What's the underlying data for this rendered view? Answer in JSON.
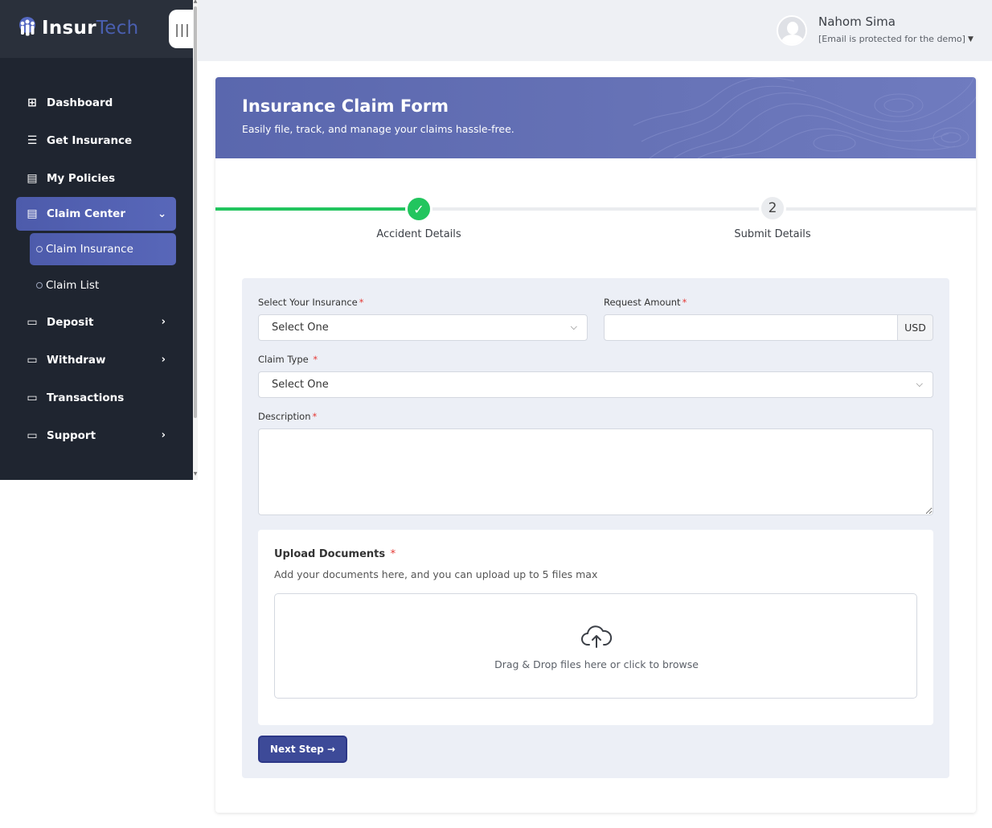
{
  "brand": {
    "name_part1": "Insur",
    "name_part2": "Tech"
  },
  "sidebar": {
    "collapse_label": "|||",
    "items": [
      {
        "label": "Dashboard",
        "icon": "grid-icon",
        "glyph": "⊞"
      },
      {
        "label": "Get Insurance",
        "icon": "list-check-icon",
        "glyph": "☰"
      },
      {
        "label": "My Policies",
        "icon": "document-icon",
        "glyph": "▤"
      },
      {
        "label": "Claim Center",
        "icon": "document-icon",
        "glyph": "▤"
      },
      {
        "label": "Deposit",
        "icon": "cash-icon",
        "glyph": "▭"
      },
      {
        "label": "Withdraw",
        "icon": "cash-icon",
        "glyph": "▭"
      },
      {
        "label": "Transactions",
        "icon": "card-icon",
        "glyph": "▭"
      },
      {
        "label": "Support",
        "icon": "ticket-icon",
        "glyph": "▭"
      }
    ],
    "claim_sub": [
      {
        "label": "Claim Insurance"
      },
      {
        "label": "Claim List"
      }
    ]
  },
  "header": {
    "user_name": "Nahom Sima",
    "user_email": "[Email is protected for the demo]"
  },
  "banner": {
    "title": "Insurance Claim Form",
    "subtitle": "Easily file, track, and manage your claims hassle-free."
  },
  "stepper": {
    "progress": 0.5,
    "steps": [
      {
        "number": "1",
        "label": "Accident Details",
        "status": "complete"
      },
      {
        "number": "2",
        "label": "Submit Details",
        "status": "pending"
      }
    ]
  },
  "form": {
    "insurance_label": "Select Your Insurance",
    "insurance_value": "Select One",
    "amount_label": "Request Amount",
    "amount_value": "",
    "currency": "USD",
    "claim_type_label": "Claim Type",
    "claim_type_value": "Select One",
    "description_label": "Description",
    "description_value": "",
    "required_mark": "*"
  },
  "upload": {
    "title": "Upload Documents",
    "subtitle": "Add your documents here, and you can upload up to 5 files max",
    "drop_text": "Drag & Drop files here or click to browse"
  },
  "next_button": "Next Step →",
  "colors": {
    "sidebar_bg": "#1f2530",
    "accent": "#4d5bab",
    "success": "#22c55e",
    "required": "#e53935",
    "button": "#3d4a98"
  }
}
